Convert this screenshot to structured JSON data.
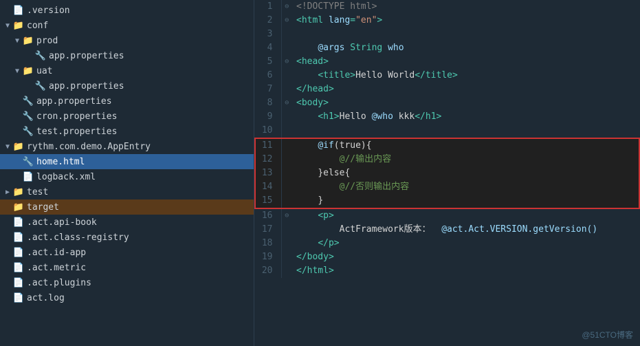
{
  "sidebar": {
    "items": [
      {
        "id": "version",
        "label": ".version",
        "level": 1,
        "type": "file",
        "arrow": "",
        "indent": 4
      },
      {
        "id": "conf",
        "label": "conf",
        "level": 1,
        "type": "folder-open",
        "arrow": "▼",
        "indent": 4
      },
      {
        "id": "prod",
        "label": "prod",
        "level": 2,
        "type": "folder-open",
        "arrow": "▼",
        "indent": 18
      },
      {
        "id": "app-prop-prod",
        "label": "app.properties",
        "level": 3,
        "type": "prop",
        "arrow": "",
        "indent": 36
      },
      {
        "id": "uat",
        "label": "uat",
        "level": 2,
        "type": "folder-open",
        "arrow": "▼",
        "indent": 18
      },
      {
        "id": "app-prop-uat",
        "label": "app.properties",
        "level": 3,
        "type": "prop",
        "arrow": "",
        "indent": 36
      },
      {
        "id": "app-prop",
        "label": "app.properties",
        "level": 2,
        "type": "prop",
        "arrow": "",
        "indent": 18
      },
      {
        "id": "cron-prop",
        "label": "cron.properties",
        "level": 2,
        "type": "prop",
        "arrow": "",
        "indent": 18
      },
      {
        "id": "test-prop",
        "label": "test.properties",
        "level": 2,
        "type": "prop",
        "arrow": "",
        "indent": 18
      },
      {
        "id": "appentry",
        "label": "rythm.com.demo.AppEntry",
        "level": 1,
        "type": "folder-open",
        "arrow": "▼",
        "indent": 4
      },
      {
        "id": "home-html",
        "label": "home.html",
        "level": 2,
        "type": "html",
        "arrow": "",
        "indent": 18,
        "selected": true
      },
      {
        "id": "logback",
        "label": "logback.xml",
        "level": 2,
        "type": "xml",
        "arrow": "",
        "indent": 18
      },
      {
        "id": "test",
        "label": "test",
        "level": 1,
        "type": "folder-closed",
        "arrow": "▶",
        "indent": 4
      },
      {
        "id": "target",
        "label": "target",
        "level": 1,
        "type": "folder-closed-orange",
        "arrow": "",
        "indent": 4
      },
      {
        "id": "act-api-book",
        "label": ".act.api-book",
        "level": 1,
        "type": "file",
        "arrow": "",
        "indent": 4
      },
      {
        "id": "act-class-registry",
        "label": ".act.class-registry",
        "level": 1,
        "type": "file",
        "arrow": "",
        "indent": 4
      },
      {
        "id": "act-id-app",
        "label": ".act.id-app",
        "level": 1,
        "type": "file",
        "arrow": "",
        "indent": 4
      },
      {
        "id": "act-metric",
        "label": ".act.metric",
        "level": 1,
        "type": "file",
        "arrow": "",
        "indent": 4
      },
      {
        "id": "act-plugins",
        "label": ".act.plugins",
        "level": 1,
        "type": "file",
        "arrow": "",
        "indent": 4
      },
      {
        "id": "act-log",
        "label": "act.log",
        "level": 1,
        "type": "file",
        "arrow": "",
        "indent": 4
      }
    ]
  },
  "code": {
    "lines": [
      {
        "num": 1,
        "fold": "⊖",
        "content": "<!DOCTYPE html>",
        "type": "doctype",
        "highlight": false
      },
      {
        "num": 2,
        "fold": "⊖",
        "content": "<html lang=\"en\">",
        "type": "tag",
        "highlight": false
      },
      {
        "num": 3,
        "fold": "",
        "content": "",
        "type": "plain",
        "highlight": false
      },
      {
        "num": 4,
        "fold": "",
        "content": "    @args String who",
        "type": "at",
        "highlight": false
      },
      {
        "num": 5,
        "fold": "⊖",
        "content": "<head>",
        "type": "tag",
        "highlight": false
      },
      {
        "num": 6,
        "fold": "",
        "content": "    <title>Hello World</title>",
        "type": "tag",
        "highlight": false
      },
      {
        "num": 7,
        "fold": "",
        "content": "</head>",
        "type": "tag",
        "highlight": false
      },
      {
        "num": 8,
        "fold": "⊖",
        "content": "<body>",
        "type": "tag",
        "highlight": false
      },
      {
        "num": 9,
        "fold": "",
        "content": "    <h1>Hello @who kkk</h1>",
        "type": "tag",
        "highlight": false
      },
      {
        "num": 10,
        "fold": "",
        "content": "",
        "type": "plain",
        "highlight": false
      },
      {
        "num": 11,
        "fold": "",
        "content": "    @if(true){",
        "type": "at",
        "highlight": true,
        "border_top": true
      },
      {
        "num": 12,
        "fold": "",
        "content": "        @//输出内容",
        "type": "comment-at",
        "highlight": true
      },
      {
        "num": 13,
        "fold": "",
        "content": "    }else{",
        "type": "at",
        "highlight": true
      },
      {
        "num": 14,
        "fold": "",
        "content": "        @//否则输出内容",
        "type": "comment-at",
        "highlight": true
      },
      {
        "num": 15,
        "fold": "",
        "content": "    }",
        "type": "at",
        "highlight": true,
        "border_bottom": true
      },
      {
        "num": 16,
        "fold": "⊖",
        "content": "    <p>",
        "type": "tag",
        "highlight": false
      },
      {
        "num": 17,
        "fold": "",
        "content": "        ActFramework版本：  @act.Act.VERSION.getVersion()",
        "type": "mixed",
        "highlight": false
      },
      {
        "num": 18,
        "fold": "",
        "content": "    </p>",
        "type": "tag",
        "highlight": false
      },
      {
        "num": 19,
        "fold": "",
        "content": "</body>",
        "type": "tag",
        "highlight": false
      },
      {
        "num": 20,
        "fold": "",
        "content": "</html>",
        "type": "tag",
        "highlight": false
      }
    ]
  },
  "watermark": "@51CTO博客"
}
